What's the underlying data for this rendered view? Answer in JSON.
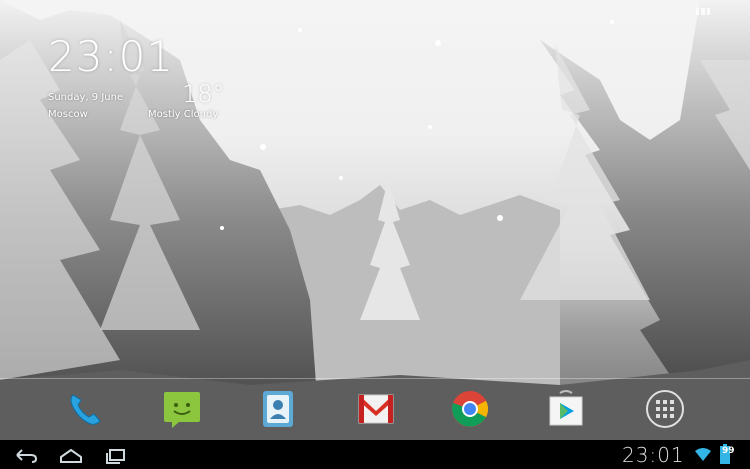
{
  "clock_widget": {
    "time": "23:01",
    "date": "Sunday, 9 June",
    "location": "Moscow",
    "temperature": "18°",
    "condition": "Mostly Cloudy"
  },
  "dock": {
    "apps": [
      "Phone",
      "Messaging",
      "People",
      "Gmail",
      "Chrome",
      "Play Store",
      "All Apps"
    ]
  },
  "status_bar": {
    "time": "23:01",
    "battery_level": "99"
  },
  "colors": {
    "nav_bar": "#000000",
    "status_text": "#e0e0e0"
  }
}
